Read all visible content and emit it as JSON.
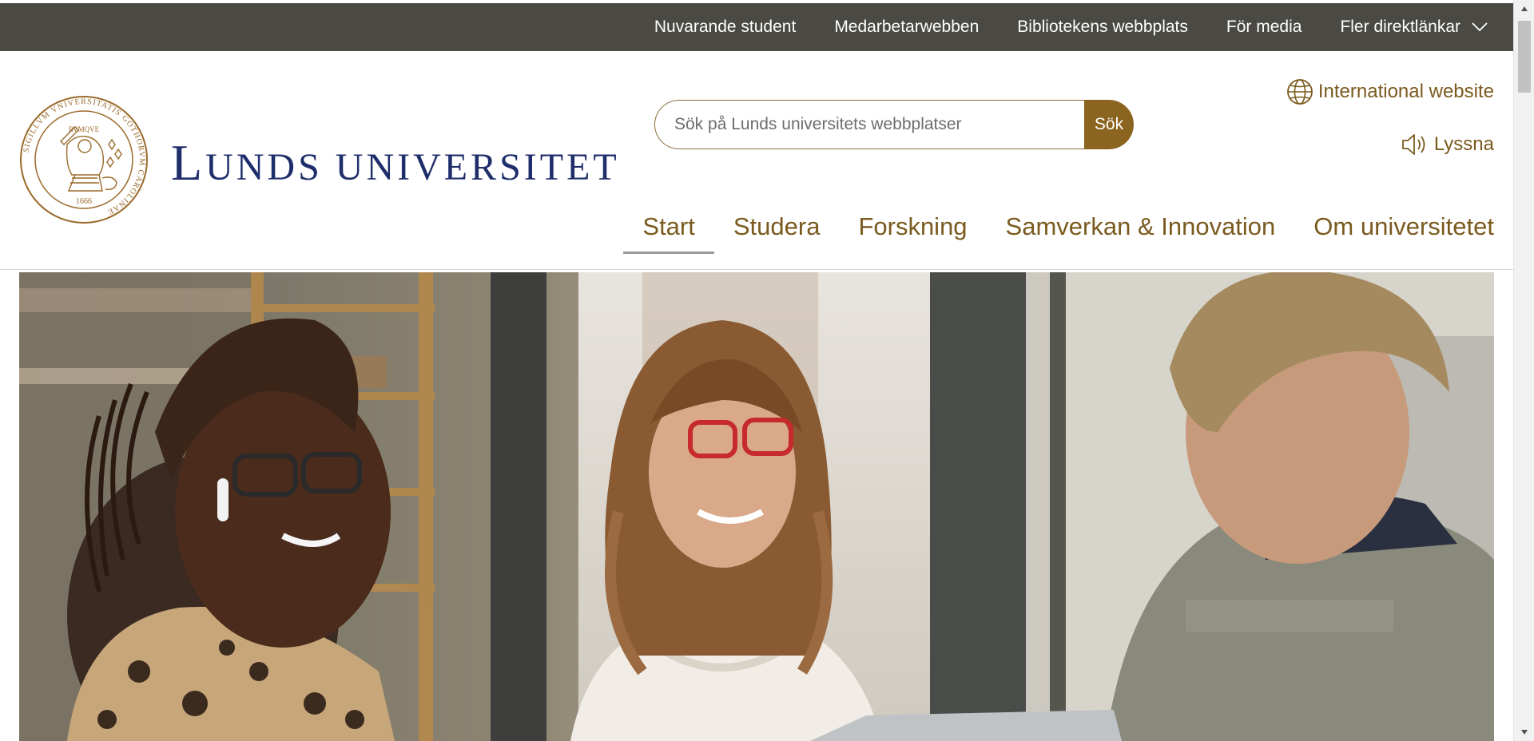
{
  "topbar": {
    "links": [
      {
        "label": "Nuvarande student"
      },
      {
        "label": "Medarbetarwebben"
      },
      {
        "label": "Bibliotekens webbplats"
      },
      {
        "label": "För media"
      },
      {
        "label": "Fler direktlänkar",
        "icon": "chevron-down-icon"
      }
    ],
    "background": "#4a4943"
  },
  "header": {
    "logo": {
      "wordmark_first": "L",
      "wordmark_rest": "UNDS UNIVERSITET",
      "seal_text": "SIGILLVM VNIVERSITATIS GOTHORVM CAROLINAE",
      "seal_banner": "RVMQVE",
      "seal_year": "1666",
      "seal_color": "#9a6a2a",
      "wordmark_color": "#1f2e6b"
    },
    "search": {
      "placeholder": "Sök på Lunds universitets webbplatser",
      "value": "",
      "button_label": "Sök"
    },
    "international": {
      "label": "International website",
      "icon": "globe-icon"
    },
    "listen": {
      "label": "Lyssna",
      "icon": "speaker-icon"
    },
    "nav": [
      {
        "label": "Start",
        "active": true
      },
      {
        "label": "Studera",
        "active": false
      },
      {
        "label": "Forskning",
        "active": false
      },
      {
        "label": "Samverkan & Innovation",
        "active": false
      },
      {
        "label": "Om universitetet",
        "active": false
      }
    ],
    "accent_color": "#8b6420"
  },
  "hero": {
    "image": "hero-photo"
  }
}
